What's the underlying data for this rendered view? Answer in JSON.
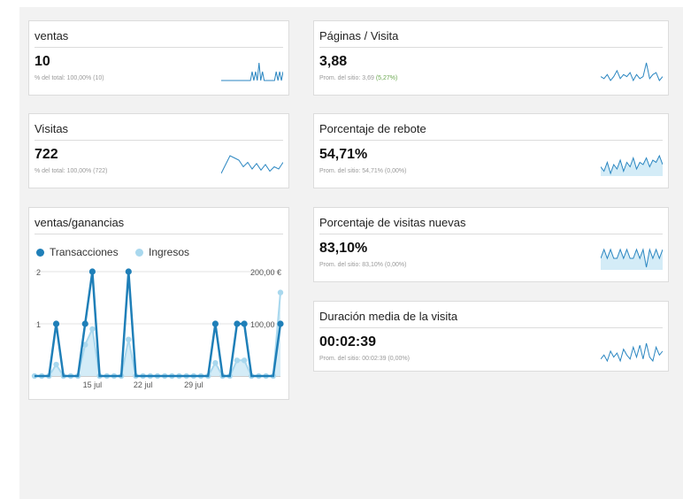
{
  "cards": {
    "ventas": {
      "title": "ventas",
      "value": "10",
      "sub_prefix": "% del total: ",
      "sub_value": "100,00% (10)"
    },
    "visitas": {
      "title": "Visitas",
      "value": "722",
      "sub_prefix": "% del total: ",
      "sub_value": "100,00% (722)"
    },
    "paginas": {
      "title": "Páginas / Visita",
      "value": "3,88",
      "sub_prefix": "Prom. del sitio: ",
      "sub_value": "3,69 ",
      "sub_pct": "(5,27%)"
    },
    "rebote": {
      "title": "Porcentaje de rebote",
      "value": "54,71%",
      "sub_prefix": "Prom. del sitio: ",
      "sub_value": "54,71% (0,00%)"
    },
    "nuevas": {
      "title": "Porcentaje de visitas nuevas",
      "value": "83,10%",
      "sub_prefix": "Prom. del sitio: ",
      "sub_value": "83,10% (0,00%)"
    },
    "duracion": {
      "title": "Duración media de la visita",
      "value": "00:02:39",
      "sub_prefix": "Prom. del sitio: ",
      "sub_value": "00:02:39 (0,00%)"
    }
  },
  "combo": {
    "title": "ventas/ganancias",
    "legend_transacciones": "Transacciones",
    "legend_ingresos": "Ingresos"
  },
  "colors": {
    "dark": "#1f7fb8",
    "light": "#a9d8ee",
    "light_fill": "#d4ecf7",
    "spark": "#2a86c1"
  },
  "chart_data": {
    "type": "line",
    "x": [
      "Jul 7",
      "Jul 8",
      "Jul 9",
      "Jul 10",
      "Jul 11",
      "Jul 12",
      "Jul 13",
      "Jul 14",
      "Jul 15",
      "Jul 16",
      "Jul 17",
      "Jul 18",
      "Jul 19",
      "Jul 20",
      "Jul 21",
      "Jul 22",
      "Jul 23",
      "Jul 24",
      "Jul 25",
      "Jul 26",
      "Jul 27",
      "Jul 28",
      "Jul 29",
      "Jul 30",
      "Jul 31",
      "Aug 1",
      "Aug 2",
      "Aug 3",
      "Aug 4",
      "Aug 5",
      "Aug 6",
      "Aug 7",
      "Aug 8",
      "Aug 9",
      "Aug 10"
    ],
    "x_tick_labels": [
      "15 jul",
      "22 jul",
      "29 jul"
    ],
    "series": [
      {
        "name": "Transacciones",
        "axis": "left",
        "values": [
          0,
          0,
          0,
          1,
          0,
          0,
          0,
          1,
          2,
          0,
          0,
          0,
          0,
          2,
          0,
          0,
          0,
          0,
          0,
          0,
          0,
          0,
          0,
          0,
          0,
          1,
          0,
          0,
          1,
          1,
          0,
          0,
          0,
          0,
          1
        ]
      },
      {
        "name": "Ingresos",
        "axis": "right",
        "values": [
          0,
          0,
          0,
          22,
          0,
          0,
          0,
          60,
          90,
          0,
          0,
          0,
          0,
          70,
          0,
          0,
          0,
          0,
          0,
          0,
          0,
          0,
          0,
          0,
          0,
          25,
          0,
          0,
          30,
          30,
          0,
          0,
          0,
          0,
          160
        ]
      }
    ],
    "y_left": {
      "ticks": [
        "2",
        "1"
      ],
      "ylim": [
        0,
        2
      ]
    },
    "y_right": {
      "ticks": [
        "200,00 €",
        "100,00 €"
      ],
      "ylim": [
        0,
        200
      ]
    }
  },
  "sparks": {
    "ventas": [
      0,
      0,
      0,
      0,
      0,
      0,
      0,
      0,
      0,
      0,
      0,
      0,
      0,
      0,
      0,
      0,
      0,
      0,
      1,
      0,
      1,
      0,
      2,
      0,
      1,
      0,
      0,
      0,
      0,
      0,
      0,
      0,
      1,
      0,
      1,
      0,
      1
    ],
    "visitas": [
      10,
      18,
      26,
      24,
      22,
      16,
      20,
      14,
      19,
      13,
      18,
      12,
      16,
      14,
      20
    ],
    "paginas": [
      5,
      4,
      6,
      3,
      5,
      8,
      4,
      6,
      5,
      7,
      3,
      6,
      4,
      5,
      12,
      4,
      6,
      7,
      3,
      5
    ],
    "rebote": [
      10,
      8,
      12,
      7,
      11,
      9,
      13,
      8,
      12,
      10,
      14,
      9,
      12,
      11,
      14,
      10,
      13,
      12,
      15,
      11
    ],
    "nuevas": [
      12,
      13,
      12,
      13,
      12,
      12,
      13,
      12,
      13,
      12,
      12,
      13,
      12,
      13,
      11,
      13,
      12,
      13,
      12,
      13
    ],
    "duracion": [
      8,
      10,
      7,
      12,
      9,
      11,
      7,
      13,
      10,
      8,
      14,
      9,
      15,
      8,
      16,
      9,
      7,
      14,
      10,
      12
    ]
  }
}
